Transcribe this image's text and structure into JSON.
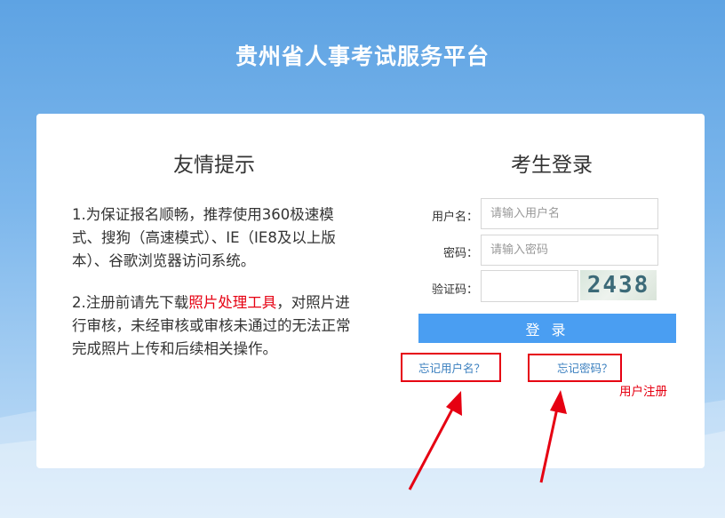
{
  "header": {
    "title": "贵州省人事考试服务平台"
  },
  "tips": {
    "title": "友情提示",
    "item1": "1.为保证报名顺畅，推荐使用360极速模式、搜狗（高速模式）、IE（IE8及以上版本）、谷歌浏览器访问系统。",
    "item2_prefix": "2.注册前请先下载",
    "item2_link": "照片处理工具",
    "item2_suffix": "，对照片进行审核，未经审核或审核未通过的无法正常完成照片上传和后续相关操作。"
  },
  "login": {
    "title": "考生登录",
    "username_label": "用户名：",
    "username_placeholder": "请输入用户名",
    "password_label": "密码：",
    "password_placeholder": "请输入密码",
    "captcha_label": "验证码：",
    "captcha_value": "2438",
    "login_button": "登 录",
    "forgot_username": "忘记用户名？",
    "forgot_password": "忘记密码？",
    "register": "用户注册"
  },
  "colors": {
    "accent": "#4a9ef2",
    "highlight": "#e60012",
    "link": "#3a7fbf"
  }
}
